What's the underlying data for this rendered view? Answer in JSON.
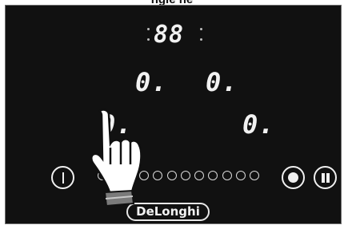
{
  "caption": "ngle ne",
  "timer": {
    "digits": "88"
  },
  "zones": {
    "top_left": "0.",
    "top_right": "0.",
    "bottom_left": "0.",
    "bottom_right": "0."
  },
  "controls": {
    "power_icon": "power-icon",
    "lock_icon": "lock-icon",
    "pause_icon": "pause-icon"
  },
  "slider": {
    "dot_count": 12
  },
  "brand": {
    "logo_text": "DeLonghi"
  },
  "colors": {
    "panel": "#111111",
    "display": "#f2f2f2",
    "outline": "#6f6f6f",
    "hand_fill": "#ffffff",
    "hand_cuff": "#7a7a7a"
  }
}
